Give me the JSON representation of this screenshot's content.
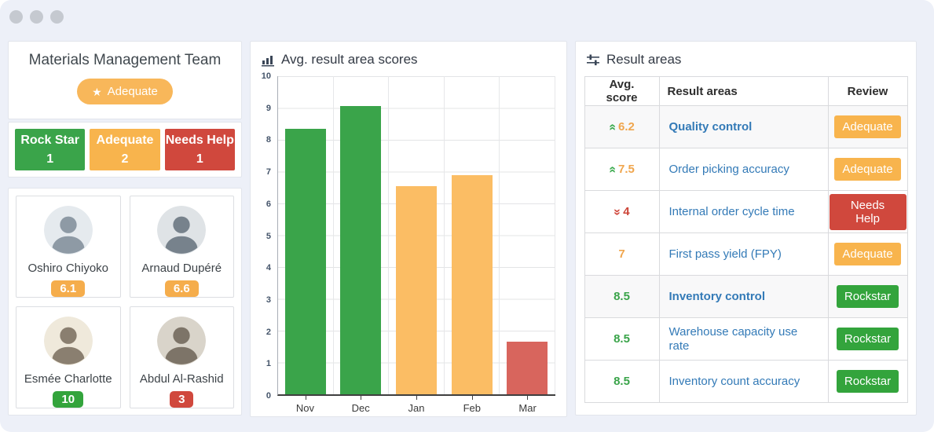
{
  "team_panel": {
    "title": "Materials Management Team",
    "badge_label": "Adequate",
    "stats": [
      {
        "label": "Rock Star",
        "count": "1",
        "color": "#3aa44a"
      },
      {
        "label": "Adequate",
        "count": "2",
        "color": "#f8b44d"
      },
      {
        "label": "Needs Help",
        "count": "1",
        "color": "#d0483d"
      }
    ],
    "members": [
      {
        "name": "Oshiro Chiyoko",
        "score": "6.1",
        "score_color": "#f5ad4c"
      },
      {
        "name": "Arnaud Dupéré",
        "score": "6.6",
        "score_color": "#f5ad4c"
      },
      {
        "name": "Esmée Charlotte",
        "score": "10",
        "score_color": "#33a43c"
      },
      {
        "name": "Abdul Al-Rashid",
        "score": "3",
        "score_color": "#d0483d"
      }
    ]
  },
  "chart_panel": {
    "title": "Avg. result area scores",
    "icon": "bar-chart-icon"
  },
  "chart_data": {
    "type": "bar",
    "title": "Avg. result area scores",
    "categories": [
      "Nov",
      "Dec",
      "Jan",
      "Feb",
      "Mar"
    ],
    "values": [
      8.35,
      9.05,
      6.55,
      6.9,
      1.65
    ],
    "colors": [
      "#3aa44a",
      "#3aa44a",
      "#fbbd64",
      "#fbbd64",
      "#d8655d"
    ],
    "ylim": [
      0,
      10
    ],
    "y_ticks": [
      "10",
      "9",
      "8",
      "7",
      "6",
      "5",
      "4",
      "3",
      "2",
      "1",
      "0"
    ],
    "grid": true,
    "xlabel": "",
    "ylabel": "",
    "legend": "none"
  },
  "results_panel": {
    "title": "Result areas",
    "icon": "sliders-icon",
    "table": {
      "headers": [
        "Avg. score",
        "Result areas",
        "Review"
      ],
      "rows": [
        {
          "score": "6.2",
          "trend": "up",
          "score_color": "#f0a64e",
          "area": "Quality control",
          "bold": true,
          "review": "Adequate",
          "review_color": "#f8b44d",
          "shaded": true
        },
        {
          "score": "7.5",
          "trend": "up",
          "score_color": "#f0a64e",
          "area": "Order picking accuracy",
          "bold": false,
          "review": "Adequate",
          "review_color": "#f8b44d",
          "shaded": false
        },
        {
          "score": "4",
          "trend": "down",
          "score_color": "#cc4437",
          "area": "Internal order cycle time",
          "bold": false,
          "review": "Needs Help",
          "review_color": "#d0483d",
          "shaded": false
        },
        {
          "score": "7",
          "trend": "none",
          "score_color": "#f0a64e",
          "area": "First pass yield (FPY)",
          "bold": false,
          "review": "Adequate",
          "review_color": "#f8b44d",
          "shaded": false
        },
        {
          "score": "8.5",
          "trend": "none",
          "score_color": "#3aa44a",
          "area": "Inventory control",
          "bold": true,
          "review": "Rockstar",
          "review_color": "#33a43c",
          "shaded": true
        },
        {
          "score": "8.5",
          "trend": "none",
          "score_color": "#3aa44a",
          "area": "Warehouse capacity use rate",
          "bold": false,
          "review": "Rockstar",
          "review_color": "#33a43c",
          "shaded": false
        },
        {
          "score": "8.5",
          "trend": "none",
          "score_color": "#3aa44a",
          "area": "Inventory count accuracy",
          "bold": false,
          "review": "Rockstar",
          "review_color": "#33a43c",
          "shaded": false
        }
      ]
    }
  }
}
